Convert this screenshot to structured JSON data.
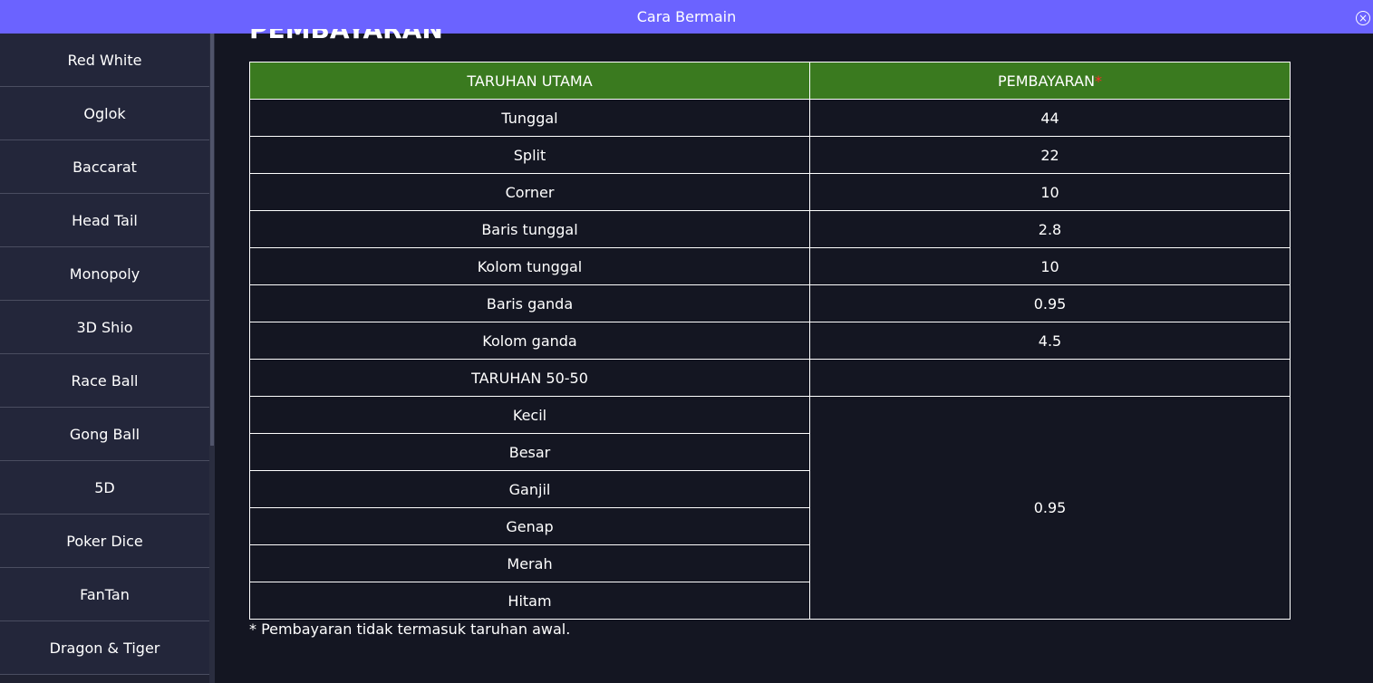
{
  "modal": {
    "title": "Cara Bermain",
    "close_icon": "×"
  },
  "sidebar": {
    "items": [
      {
        "label": "Red White"
      },
      {
        "label": "Oglok"
      },
      {
        "label": "Baccarat"
      },
      {
        "label": "Head Tail"
      },
      {
        "label": "Monopoly"
      },
      {
        "label": "3D Shio"
      },
      {
        "label": "Race Ball"
      },
      {
        "label": "Gong Ball"
      },
      {
        "label": "5D"
      },
      {
        "label": "Poker Dice"
      },
      {
        "label": "FanTan"
      },
      {
        "label": "Dragon & Tiger"
      }
    ]
  },
  "content": {
    "section_heading": "PEMBAYARAN",
    "table": {
      "headers": {
        "col1": "TARUHAN UTAMA",
        "col2": "PEMBAYARAN",
        "col2_mark": "*"
      },
      "rows": [
        {
          "bet": "Tunggal",
          "payout": "44"
        },
        {
          "bet": "Split",
          "payout": "22"
        },
        {
          "bet": "Corner",
          "payout": "10"
        },
        {
          "bet": "Baris tunggal",
          "payout": "2.8"
        },
        {
          "bet": "Kolom tunggal",
          "payout": "10"
        },
        {
          "bet": "Baris ganda",
          "payout": "0.95"
        },
        {
          "bet": "Kolom ganda",
          "payout": "4.5"
        }
      ],
      "subheader": "TARUHAN 50-50",
      "group_rows": [
        {
          "bet": "Kecil"
        },
        {
          "bet": "Besar"
        },
        {
          "bet": "Ganjil"
        },
        {
          "bet": "Genap"
        },
        {
          "bet": "Merah"
        },
        {
          "bet": "Hitam"
        }
      ],
      "group_payout": "0.95"
    },
    "footnote": "* Pembayaran tidak termasuk taruhan awal."
  },
  "colors": {
    "topbar": "#6b63ff",
    "page_bg": "#141622",
    "sidebar_bg": "#23263a",
    "table_header": "#3a7a1f",
    "asterisk": "#ff2a2a"
  }
}
